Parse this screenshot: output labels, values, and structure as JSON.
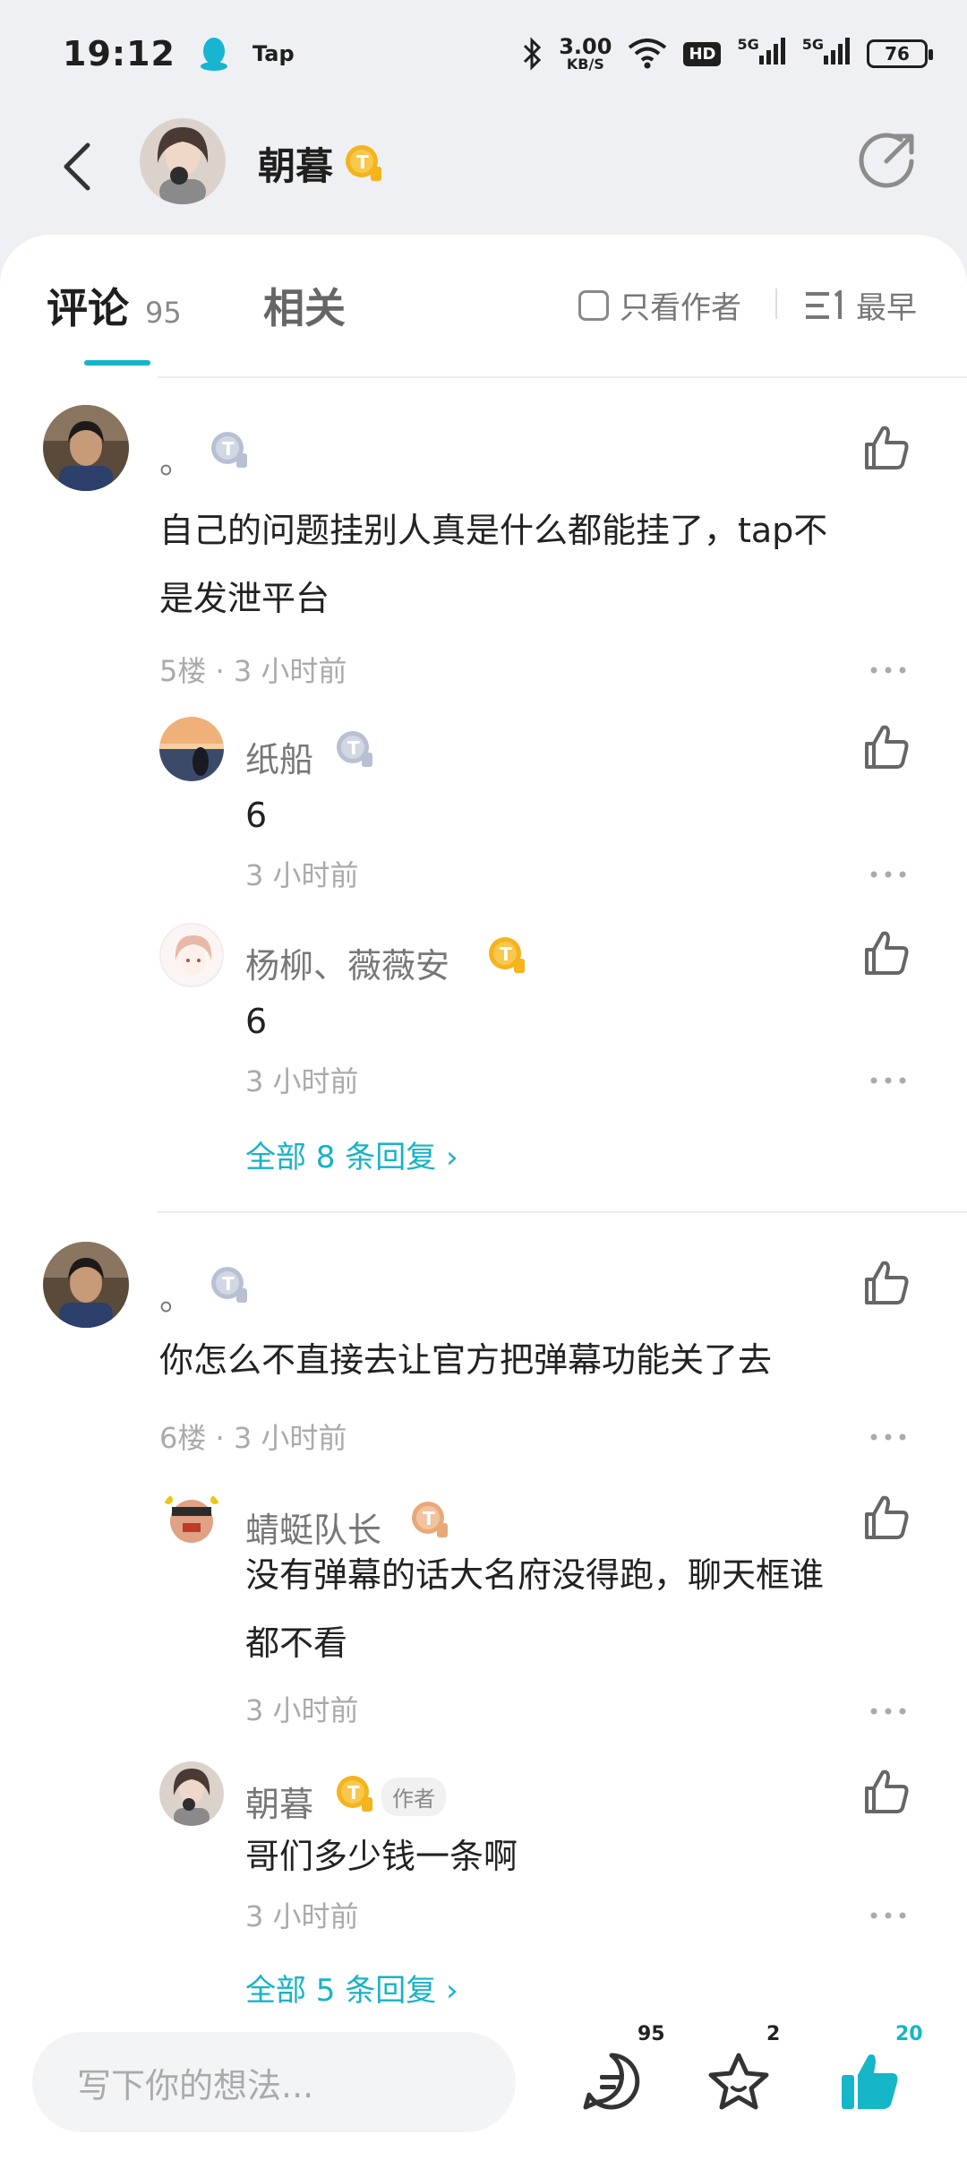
{
  "status_bar": {
    "time": "19:12",
    "app_label": "Tap",
    "net_speed": "3.00",
    "net_unit": "KB/S",
    "hd": "HD",
    "sig1": "5G",
    "sig2": "5G",
    "battery": "76"
  },
  "header": {
    "name": "朝暮"
  },
  "tabs": {
    "comments_label": "评论",
    "comments_count": "95",
    "related_label": "相关",
    "author_only": "只看作者",
    "sort_label": "最早"
  },
  "comments": [
    {
      "name": "。",
      "text_line1": "自己的问题挂别人真是什么都能挂了，tap不",
      "text_line2": "是发泄平台",
      "meta": "5楼 · 3 小时前",
      "replies": [
        {
          "name": "纸船",
          "text": "6",
          "meta": "3 小时前"
        },
        {
          "name": "杨柳、薇薇安",
          "text": "6",
          "meta": "3 小时前"
        }
      ],
      "all_replies": "全部 8 条回复 ›"
    },
    {
      "name": "。",
      "text_line1": "你怎么不直接去让官方把弹幕功能关了去",
      "meta": "6楼 · 3 小时前",
      "replies": [
        {
          "name": "蜻蜓队长",
          "text_line1": "没有弹幕的话大名府没得跑，聊天框谁",
          "text_line2": "都不看",
          "meta": "3 小时前"
        },
        {
          "name": "朝暮",
          "author_tag": "作者",
          "text": "哥们多少钱一条啊",
          "meta": "3 小时前"
        }
      ],
      "all_replies": "全部 5 条回复 ›"
    }
  ],
  "bottom": {
    "placeholder": "写下你的想法...",
    "comment_count": "95",
    "favorite_count": "2",
    "like_count": "20"
  },
  "colors": {
    "accent": "#14b6c8",
    "gold_badge": "#f5b31c",
    "silver_badge": "#b9c0d3"
  }
}
